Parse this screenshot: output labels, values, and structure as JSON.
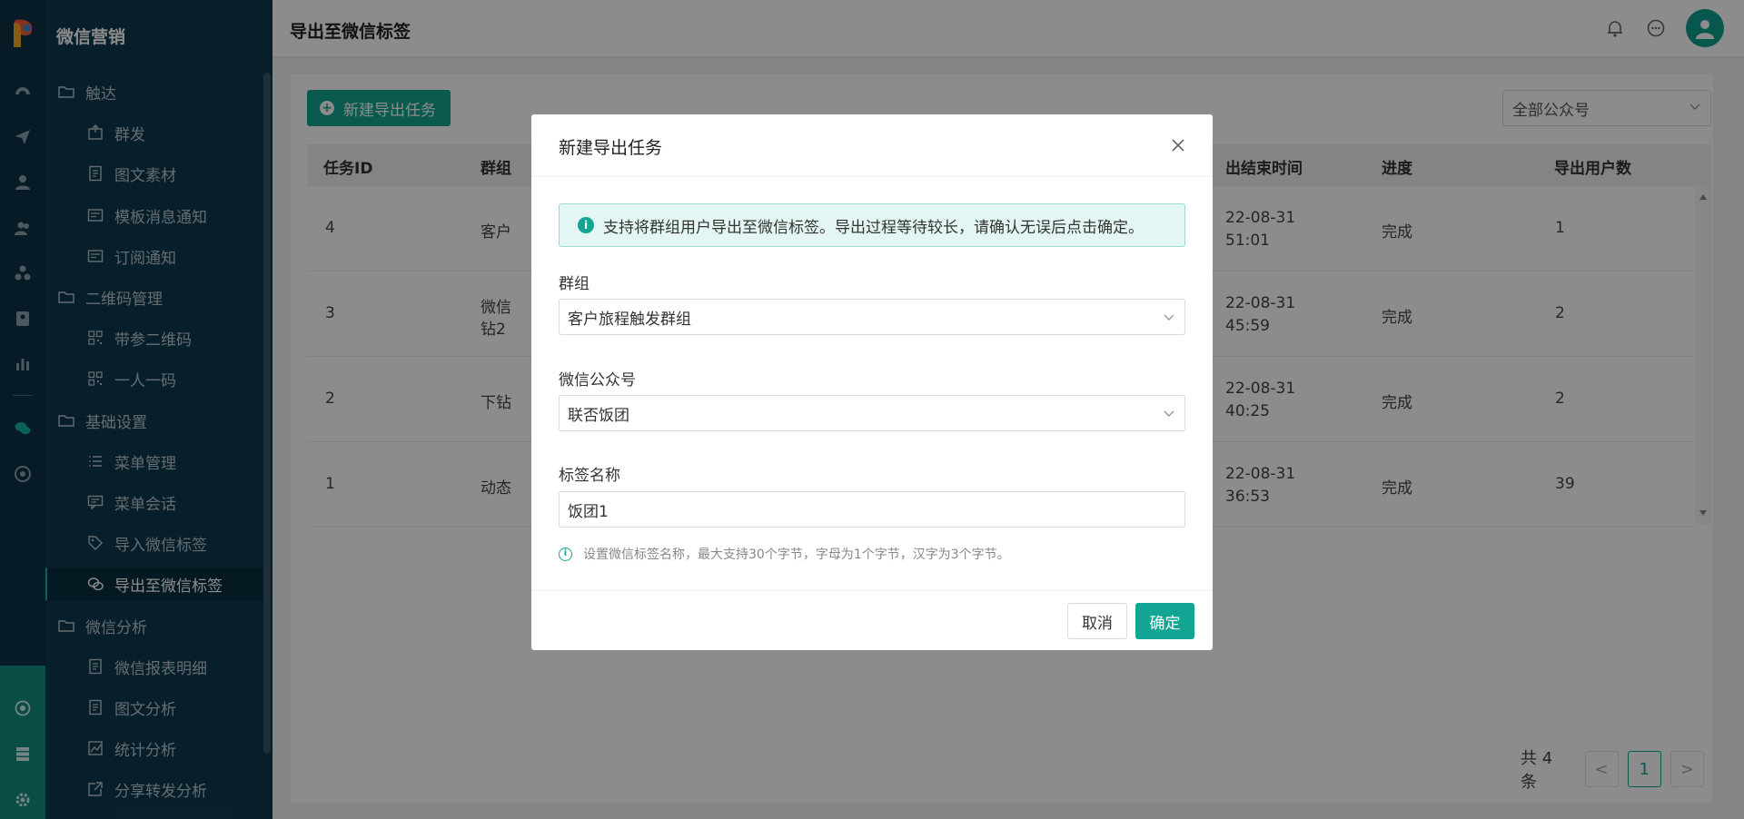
{
  "app": {
    "brand": "微信营销"
  },
  "header": {
    "title": "导出至微信标签"
  },
  "menu": [
    {
      "label": "触达",
      "level": 1,
      "icon": "folder-icon"
    },
    {
      "label": "群发",
      "level": 2,
      "icon": "send-doc-icon"
    },
    {
      "label": "图文素材",
      "level": 2,
      "icon": "document-icon"
    },
    {
      "label": "模板消息通知",
      "level": 2,
      "icon": "template-icon"
    },
    {
      "label": "订阅通知",
      "level": 2,
      "icon": "template-icon"
    },
    {
      "label": "二维码管理",
      "level": 1,
      "icon": "folder-icon"
    },
    {
      "label": "带参二维码",
      "level": 2,
      "icon": "qrcode-icon"
    },
    {
      "label": "一人一码",
      "level": 2,
      "icon": "qrcode-icon"
    },
    {
      "label": "基础设置",
      "level": 1,
      "icon": "folder-icon"
    },
    {
      "label": "菜单管理",
      "level": 2,
      "icon": "list-icon"
    },
    {
      "label": "菜单会话",
      "level": 2,
      "icon": "chat-icon"
    },
    {
      "label": "导入微信标签",
      "level": 2,
      "icon": "tag-icon"
    },
    {
      "label": "导出至微信标签",
      "level": 2,
      "icon": "wechat-icon",
      "active": true
    },
    {
      "label": "微信分析",
      "level": 1,
      "icon": "folder-icon"
    },
    {
      "label": "微信报表明细",
      "level": 2,
      "icon": "document-icon"
    },
    {
      "label": "图文分析",
      "level": 2,
      "icon": "document-icon"
    },
    {
      "label": "统计分析",
      "level": 2,
      "icon": "chart-icon"
    },
    {
      "label": "分享转发分析",
      "level": 2,
      "icon": "share-icon"
    }
  ],
  "toolbar": {
    "new_task_label": "新建导出任务",
    "account_select": "全部公众号"
  },
  "table": {
    "headers": [
      "任务ID",
      "群组",
      "出结束时间",
      "进度",
      "导出用户数"
    ],
    "rows": [
      {
        "id": "4",
        "group_l1": "客户",
        "group_l2": "",
        "time_l1": "22-08-31",
        "time_l2": "51:01",
        "progress": "完成",
        "count": "1"
      },
      {
        "id": "3",
        "group_l1": "微信",
        "group_l2": "钻2",
        "time_l1": "22-08-31",
        "time_l2": "45:59",
        "progress": "完成",
        "count": "2"
      },
      {
        "id": "2",
        "group_l1": "下钻",
        "group_l2": "",
        "time_l1": "22-08-31",
        "time_l2": "40:25",
        "progress": "完成",
        "count": "2"
      },
      {
        "id": "1",
        "group_l1": "动态",
        "group_l2": "",
        "time_l1": "22-08-31",
        "time_l2": "36:53",
        "progress": "完成",
        "count": "39"
      }
    ]
  },
  "pager": {
    "total": "共 4 条",
    "current": "1",
    "prev": "<",
    "next": ">"
  },
  "modal": {
    "title": "新建导出任务",
    "alert": "支持将群组用户导出至微信标签。导出过程等待较长，请确认无误后点击确定。",
    "group_label": "群组",
    "group_value": "客户旅程触发群组",
    "account_label": "微信公众号",
    "account_value": "联否饭团",
    "tag_label": "标签名称",
    "tag_value": "饭团1",
    "hint": "设置微信标签名称，最大支持30个字节，字母为1个字节，汉字为3个字节。",
    "cancel_label": "取消",
    "ok_label": "确定"
  },
  "colors": {
    "accent": "#13a593",
    "sidebar": "#0e3a4f",
    "rail": "#0c3246"
  }
}
